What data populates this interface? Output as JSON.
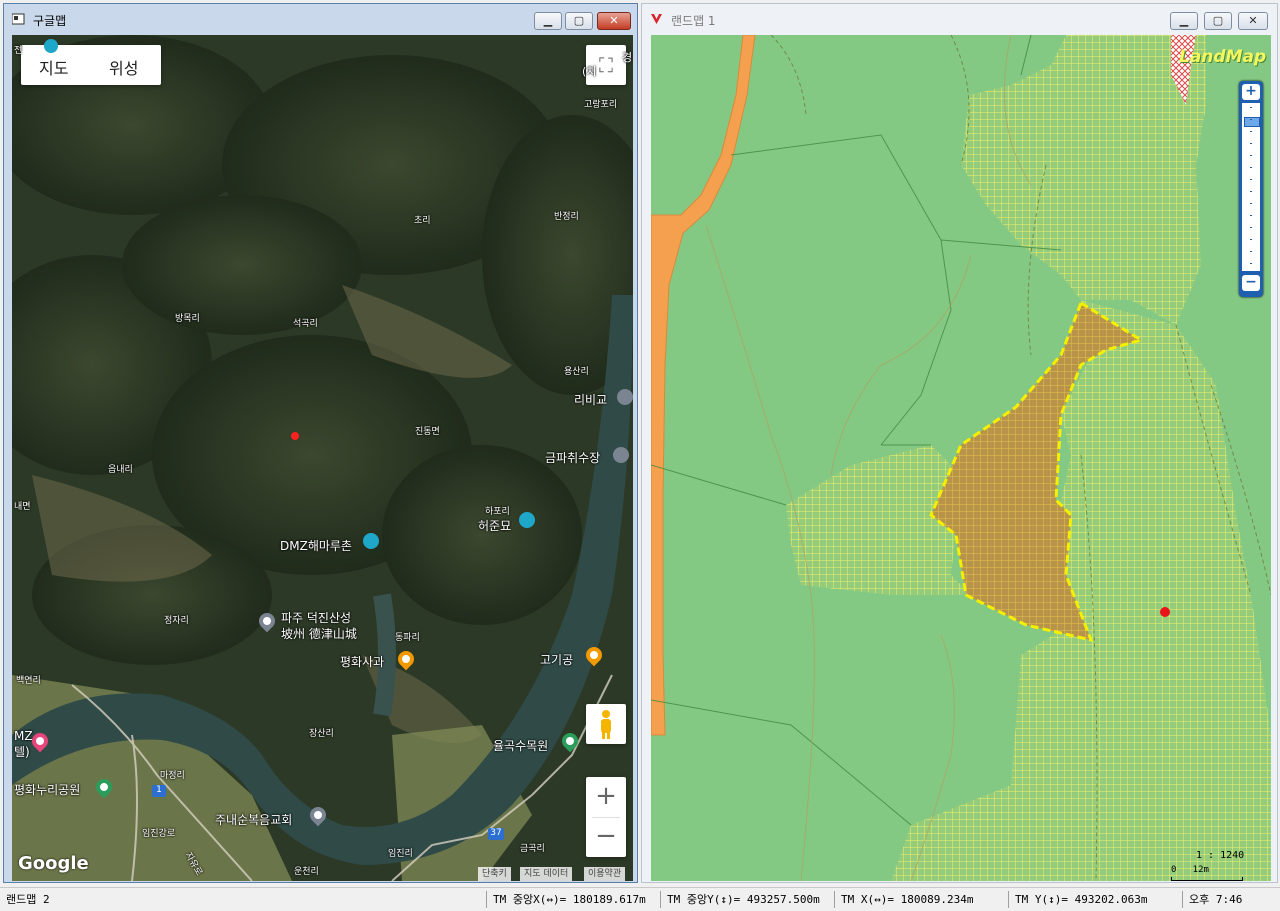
{
  "google_window": {
    "title": "구글맵",
    "map_type": {
      "map": "지도",
      "satellite": "위성"
    },
    "zoom_in": "+",
    "zoom_out": "−",
    "fullscreen": "⛶",
    "logo": "Google",
    "footer": {
      "shortcuts": "단축키",
      "map_data": "지도 데이터",
      "terms": "이용약관"
    },
    "labels": {
      "jeon": "전",
      "gyeong": "경",
      "chi": "(치",
      "gorangpo": "고랑포리",
      "cho": "초리",
      "banjeong": "반정리",
      "bangmok": "방목리",
      "seokgok": "석곡리",
      "yongsan": "용산리",
      "ribigyo": "리비교",
      "jindong": "진동면",
      "geumpa": "금파취수장",
      "eupnae": "읍내리",
      "naemyeon": "내면",
      "hapo": "하포리",
      "heojunmyo": "허준묘",
      "dmz_haemaru": "DMZ해마루촌",
      "jeongja": "정자리",
      "deokjin_ko": "파주 덕진산성",
      "deokjin_cn": "坡州 德津山城",
      "dongpa": "동파리",
      "pyeonghwa_apple": "평화사과",
      "gogigong": "고기공",
      "baekyeon": "백연리",
      "dmz_left": "MZ",
      "dmz_left2": "텔)",
      "jangsan": "장산리",
      "yulgok": "율곡수목원",
      "majeong": "마정리",
      "pyeonghwa_park": "평화누리공원",
      "route1": "1",
      "imjingang": "임진강로",
      "junae": "주내순복음교회",
      "route37": "37",
      "geumgok": "금곡리",
      "imjin": "임진리",
      "uncheon": "운천리",
      "jasopro": "자유로"
    }
  },
  "land_window": {
    "title": "랜드맵 1",
    "logo": "LandMap",
    "scale_ratio": "1 : 1240",
    "scale_bar": "0   12m"
  },
  "statusbar": {
    "app": "랜드맵 2",
    "tm_center_x": "TM 중앙X(↔)= 180189.617m",
    "tm_center_y": "TM 중앙Y(↕)= 493257.500m",
    "tm_x": "TM X(↔)= 180089.234m",
    "tm_y": "TM Y(↕)= 493202.063m",
    "clock": "오후 7:46"
  },
  "colors": {
    "land_green": "#84c983",
    "hatch_yellow": "#f2f26a",
    "parcel_fill": "#b8934a",
    "road_orange": "#f4a04e",
    "marker_red": "#e8141a",
    "zoom_blue": "#1f5fb0"
  }
}
